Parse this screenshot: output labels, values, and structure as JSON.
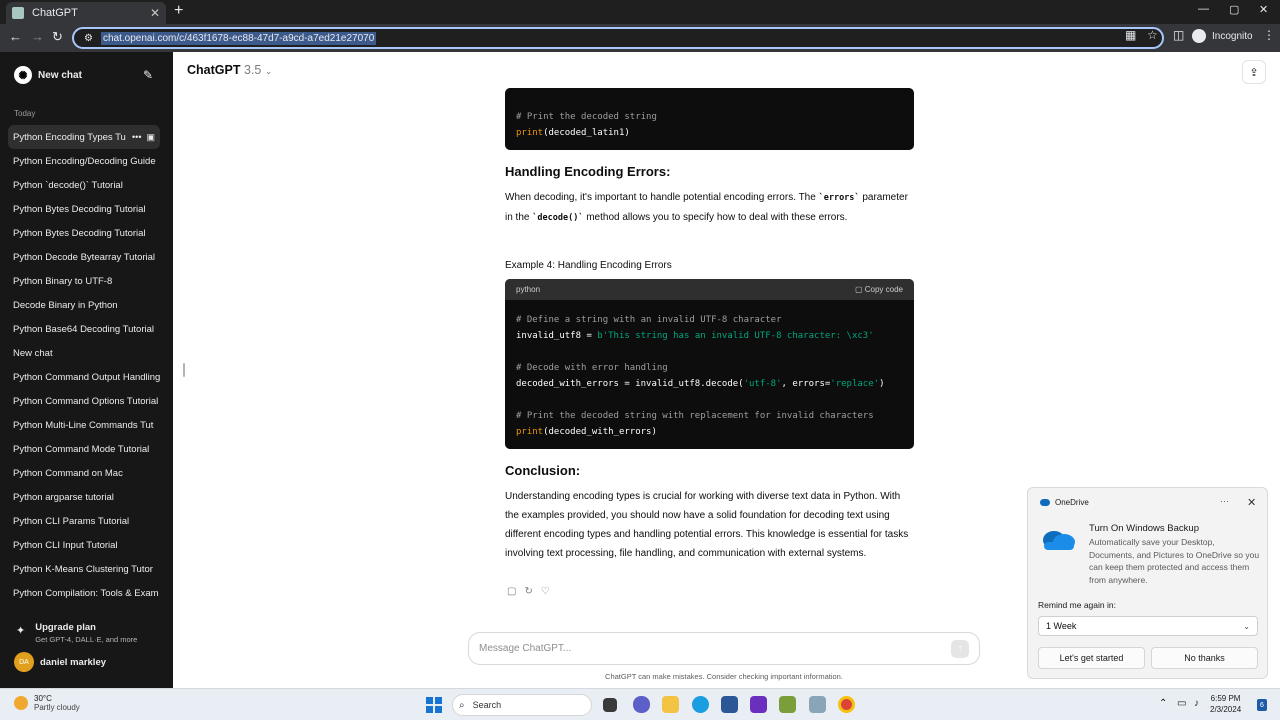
{
  "browser": {
    "tab_title": "ChatGPT",
    "tab_close": "✕",
    "new_tab": "+",
    "url": "chat.openai.com/c/463f1678-ec88-47d7-a9cd-a7ed21e27070",
    "incognito_label": "Incognito",
    "controls": {
      "minimize": "—",
      "maximize": "▢",
      "close": "✕"
    }
  },
  "sidebar": {
    "new_chat": "New chat",
    "section_today": "Today",
    "items": [
      {
        "label": "Python Encoding Types Tu"
      },
      {
        "label": "Python Encoding/Decoding Guide"
      },
      {
        "label": "Python `decode()` Tutorial"
      },
      {
        "label": "Python Bytes Decoding Tutorial"
      },
      {
        "label": "Python Bytes Decoding Tutorial"
      },
      {
        "label": "Python Decode Bytearray Tutorial"
      },
      {
        "label": "Python Binary to UTF-8"
      },
      {
        "label": "Decode Binary in Python"
      },
      {
        "label": "Python Base64 Decoding Tutorial"
      },
      {
        "label": "New chat"
      },
      {
        "label": "Python Command Output Handling"
      },
      {
        "label": "Python Command Options Tutorial"
      },
      {
        "label": "Python Multi-Line Commands Tut"
      },
      {
        "label": "Python Command Mode Tutorial"
      },
      {
        "label": "Python Command on Mac"
      },
      {
        "label": "Python argparse tutorial"
      },
      {
        "label": "Python CLI Params Tutorial"
      },
      {
        "label": "Python CLI Input Tutorial"
      },
      {
        "label": "Python K-Means Clustering Tutor"
      },
      {
        "label": "Python Compilation: Tools & Exam"
      }
    ],
    "upgrade_title": "Upgrade plan",
    "upgrade_sub": "Get GPT-4, DALL·E, and more",
    "user_initials": "DA",
    "user_name": "daniel markley"
  },
  "header": {
    "model_name": "ChatGPT",
    "model_version": "3.5"
  },
  "content": {
    "code1_comment": "# Print the decoded string",
    "code1_fn": "print",
    "code1_arg": "(decoded_latin1)",
    "heading_errors": "Handling Encoding Errors:",
    "errors_p1": "When decoding, it's important to handle potential encoding errors. The",
    "errors_code1": "`errors`",
    "errors_p2": "parameter in the",
    "errors_code2": "`decode()`",
    "errors_p3": "method allows you to specify how to deal with these errors.",
    "example4": "Example 4: Handling Encoding Errors",
    "code2_lang": "python",
    "code2_copy": "Copy code",
    "code2_c1": "# Define a string with an invalid UTF-8 character",
    "code2_l2a": "invalid_utf8 = ",
    "code2_l2b": "b'This string has an invalid UTF-8 character: \\xc3'",
    "code2_c2": "# Decode with error handling",
    "code2_l4a": "decoded_with_errors = invalid_utf8.decode(",
    "code2_l4b": "'utf-8'",
    "code2_l4c": ", errors=",
    "code2_l4d": "'replace'",
    "code2_l4e": ")",
    "code2_c3": "# Print the decoded string with replacement for invalid characters",
    "code2_fn": "print",
    "code2_l6": "(decoded_with_errors)",
    "heading_conclusion": "Conclusion:",
    "conclusion": "Understanding encoding types is crucial for working with diverse text data in Python. With the examples provided, you should now have a solid foundation for decoding text using different encoding types and handling potential errors. This knowledge is essential for tasks involving text processing, file handling, and communication with external systems."
  },
  "composer": {
    "placeholder": "Message ChatGPT...",
    "disclaimer": "ChatGPT can make mistakes. Consider checking important information."
  },
  "onedrive": {
    "app": "OneDrive",
    "title": "Turn On Windows Backup",
    "body": "Automatically save your Desktop, Documents, and Pictures to OneDrive so you can keep them protected and access them from anywhere.",
    "remind_label": "Remind me again in:",
    "remind_value": "1 Week",
    "primary": "Let's get started",
    "secondary": "No thanks"
  },
  "taskbar": {
    "temp": "30°C",
    "condition": "Partly cloudy",
    "search": "Search",
    "time": "6:59 PM",
    "date": "2/3/2024",
    "notification_count": "6"
  },
  "colors": {
    "accent_orange": "#e9950c",
    "string_green": "#00a67d",
    "sidebar_bg": "#171717"
  }
}
